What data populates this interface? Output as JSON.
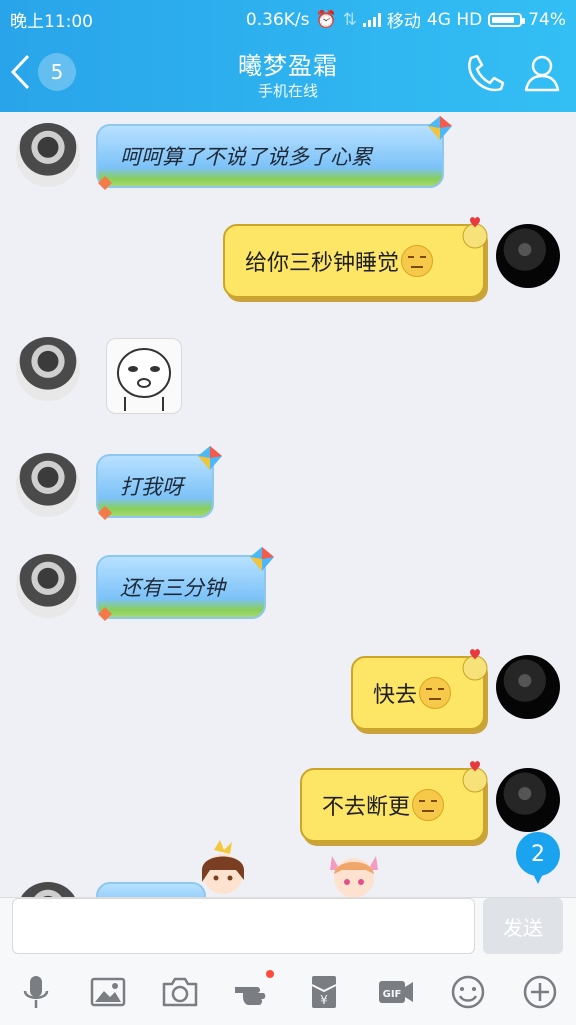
{
  "status_bar": {
    "time": "晚上11:00",
    "network_speed": "0.36K/s",
    "carrier": "移动",
    "network_type": "4G HD",
    "battery": "74%"
  },
  "header": {
    "back_count": "5",
    "title": "曦梦盈霜",
    "subtitle": "手机在线"
  },
  "messages": [
    {
      "side": "friend",
      "type": "text",
      "text": "呵呵算了不说了说多了心累"
    },
    {
      "side": "me",
      "type": "text",
      "text": "给你三秒钟睡觉"
    },
    {
      "side": "friend",
      "type": "sticker",
      "sticker_icon": "face-sticker"
    },
    {
      "side": "friend",
      "type": "text",
      "text": "打我呀"
    },
    {
      "side": "friend",
      "type": "text",
      "text": "还有三分钟"
    },
    {
      "side": "me",
      "type": "text",
      "text": "快去"
    },
    {
      "side": "me",
      "type": "text",
      "text": "不去断更"
    }
  ],
  "unread_badge": "2",
  "input": {
    "placeholder": "",
    "send_label": "发送"
  },
  "toolbar_icons": [
    "microphone-icon",
    "image-icon",
    "camera-icon",
    "poke-icon",
    "red-packet-icon",
    "gif-icon",
    "emoji-icon",
    "plus-icon"
  ],
  "colors": {
    "header_blue": "#29a4ea",
    "bubble_blue": "#7cc2f8",
    "bubble_yellow": "#fde566",
    "unread_blue": "#1aa3ee"
  }
}
